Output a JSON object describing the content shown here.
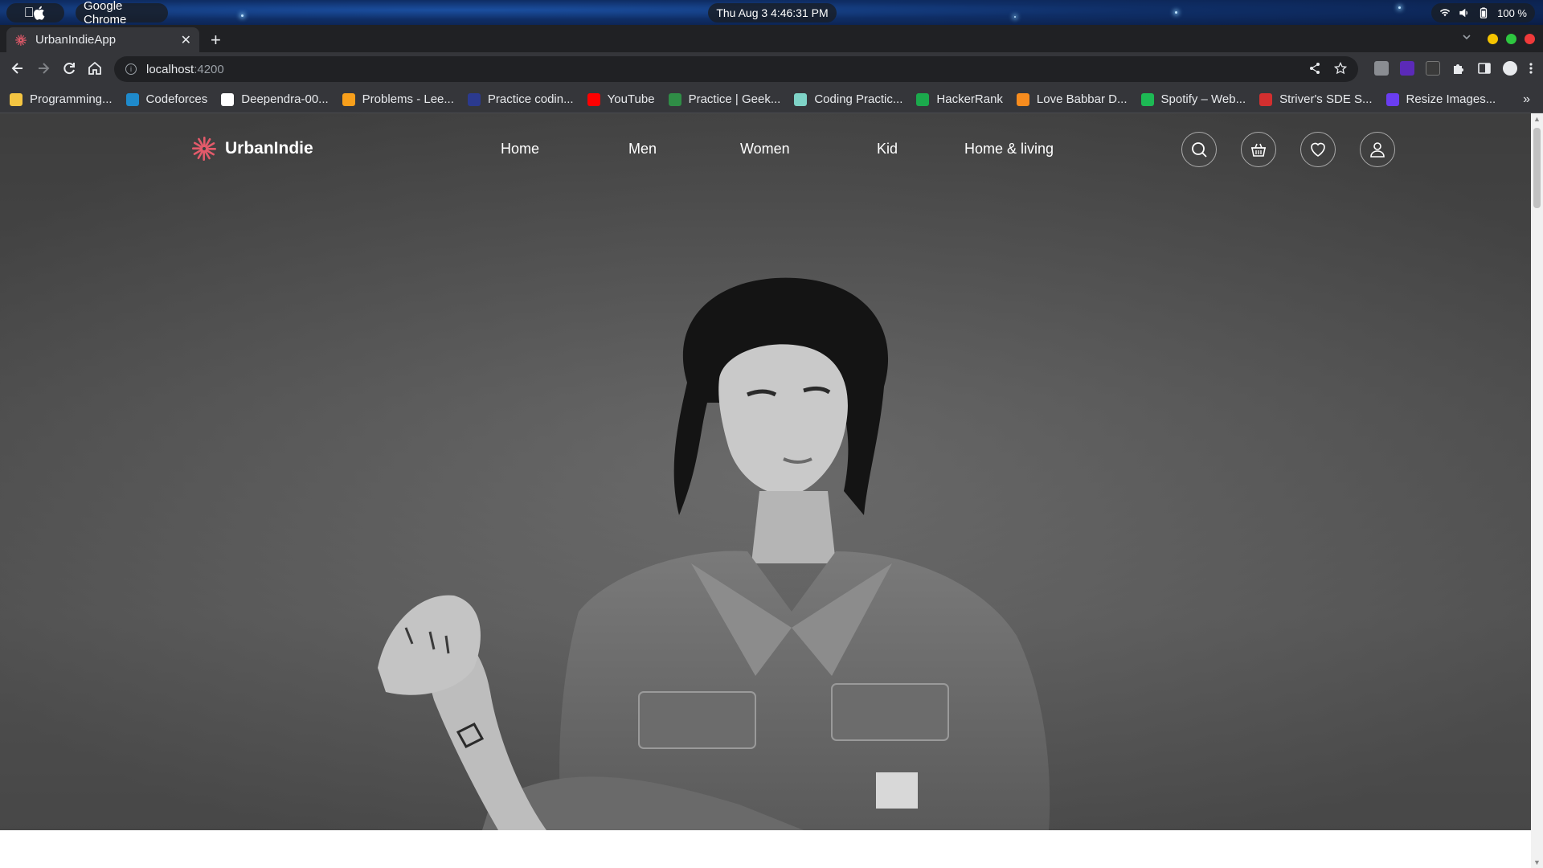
{
  "os": {
    "app_name": "Google Chrome",
    "clock": "Thu Aug 3   4:46:31 PM",
    "battery": "100 %"
  },
  "browser": {
    "tab_title": "UrbanIndieApp",
    "tab_close": "✕",
    "new_tab": "+",
    "url_host": "localhost",
    "url_port": ":4200",
    "bookmarks": [
      {
        "label": "Programming...",
        "color": "#f4c542"
      },
      {
        "label": "Codeforces",
        "color": "#1f8acb"
      },
      {
        "label": "Deependra-00...",
        "color": "#ffffff"
      },
      {
        "label": "Problems - Lee...",
        "color": "#f89f1b"
      },
      {
        "label": "Practice codin...",
        "color": "#2b3a8f"
      },
      {
        "label": "YouTube",
        "color": "#ff0000"
      },
      {
        "label": "Practice | Geek...",
        "color": "#2f8d46"
      },
      {
        "label": "Coding Practic...",
        "color": "#7fd3c7"
      },
      {
        "label": "HackerRank",
        "color": "#1ba94c"
      },
      {
        "label": "Love Babbar D...",
        "color": "#f78c1e"
      },
      {
        "label": "Spotify – Web...",
        "color": "#1db954"
      },
      {
        "label": "Striver's SDE S...",
        "color": "#d32f2f"
      },
      {
        "label": "Resize Images...",
        "color": "#6a3df0"
      }
    ],
    "more": "»"
  },
  "site": {
    "brand": "UrbanIndie",
    "brand_color": "#e35a6a",
    "nav": {
      "home": "Home",
      "men": "Men",
      "women": "Women",
      "kid": "Kid",
      "home_living": "Home & living"
    }
  }
}
